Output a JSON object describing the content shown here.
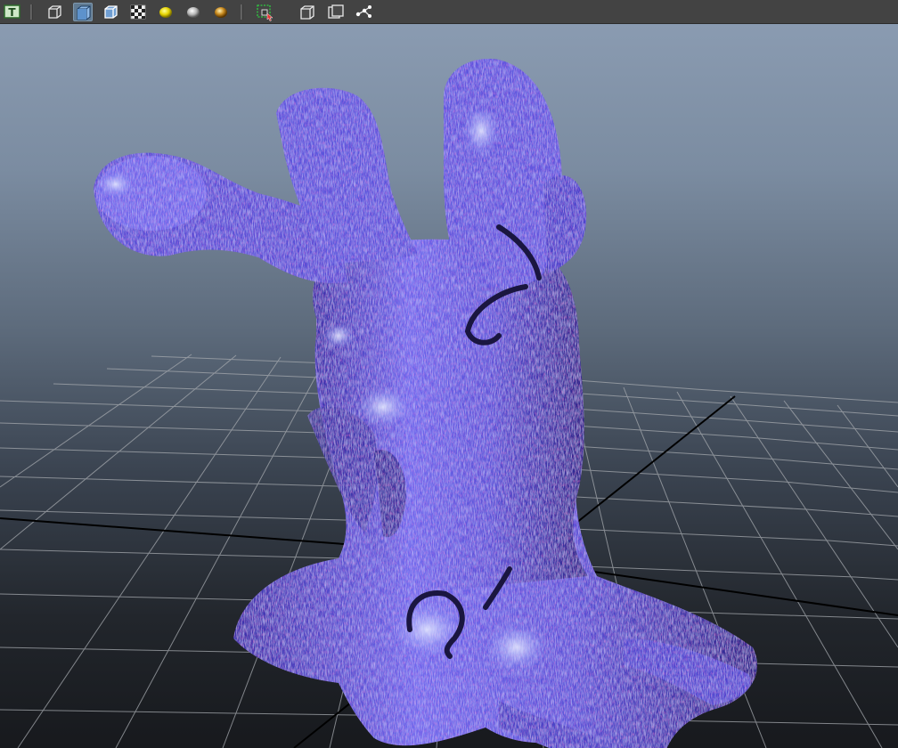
{
  "toolbar": {
    "items": [
      {
        "name": "text-mode-button",
        "icon": "text-t-icon",
        "active": false
      },
      {
        "name": "wireframe-shading-button",
        "icon": "wireframe-cube-icon",
        "active": false
      },
      {
        "name": "smooth-shading-button",
        "icon": "smooth-shaded-cube-icon",
        "active": true
      },
      {
        "name": "wireframe-on-shaded-button",
        "icon": "wireframe-on-shaded-icon",
        "active": false
      },
      {
        "name": "textured-button",
        "icon": "checker-texture-icon",
        "active": false
      },
      {
        "name": "use-all-lights-button",
        "icon": "light-yellow-sphere-icon",
        "active": false
      },
      {
        "name": "shadows-button",
        "icon": "grey-sphere-icon",
        "active": false
      },
      {
        "name": "screen-space-ao-button",
        "icon": "gold-sphere-icon",
        "active": false
      },
      {
        "name": "isolate-select-button",
        "icon": "isolate-select-icon",
        "active": false
      },
      {
        "name": "xray-button",
        "icon": "xray-cube-icon",
        "active": false
      },
      {
        "name": "xray-joints-button",
        "icon": "xray-frame-icon",
        "active": false
      },
      {
        "name": "xray-components-button",
        "icon": "joint-tree-icon",
        "active": false
      }
    ],
    "text_icon_glyph": "T",
    "colors": {
      "toolbar_bg": "#434343",
      "active_button": "#607a92"
    }
  },
  "viewport": {
    "background_top": "#8a9bb1",
    "background_bottom": "#17191d",
    "grid_color": "#a5a9ae",
    "axis_color": "#000000",
    "model": {
      "name": "tree-stump-mesh",
      "base_color": "#5a50d8",
      "highlight_color": "#9da8ff",
      "shadow_color": "#2a2470"
    }
  }
}
